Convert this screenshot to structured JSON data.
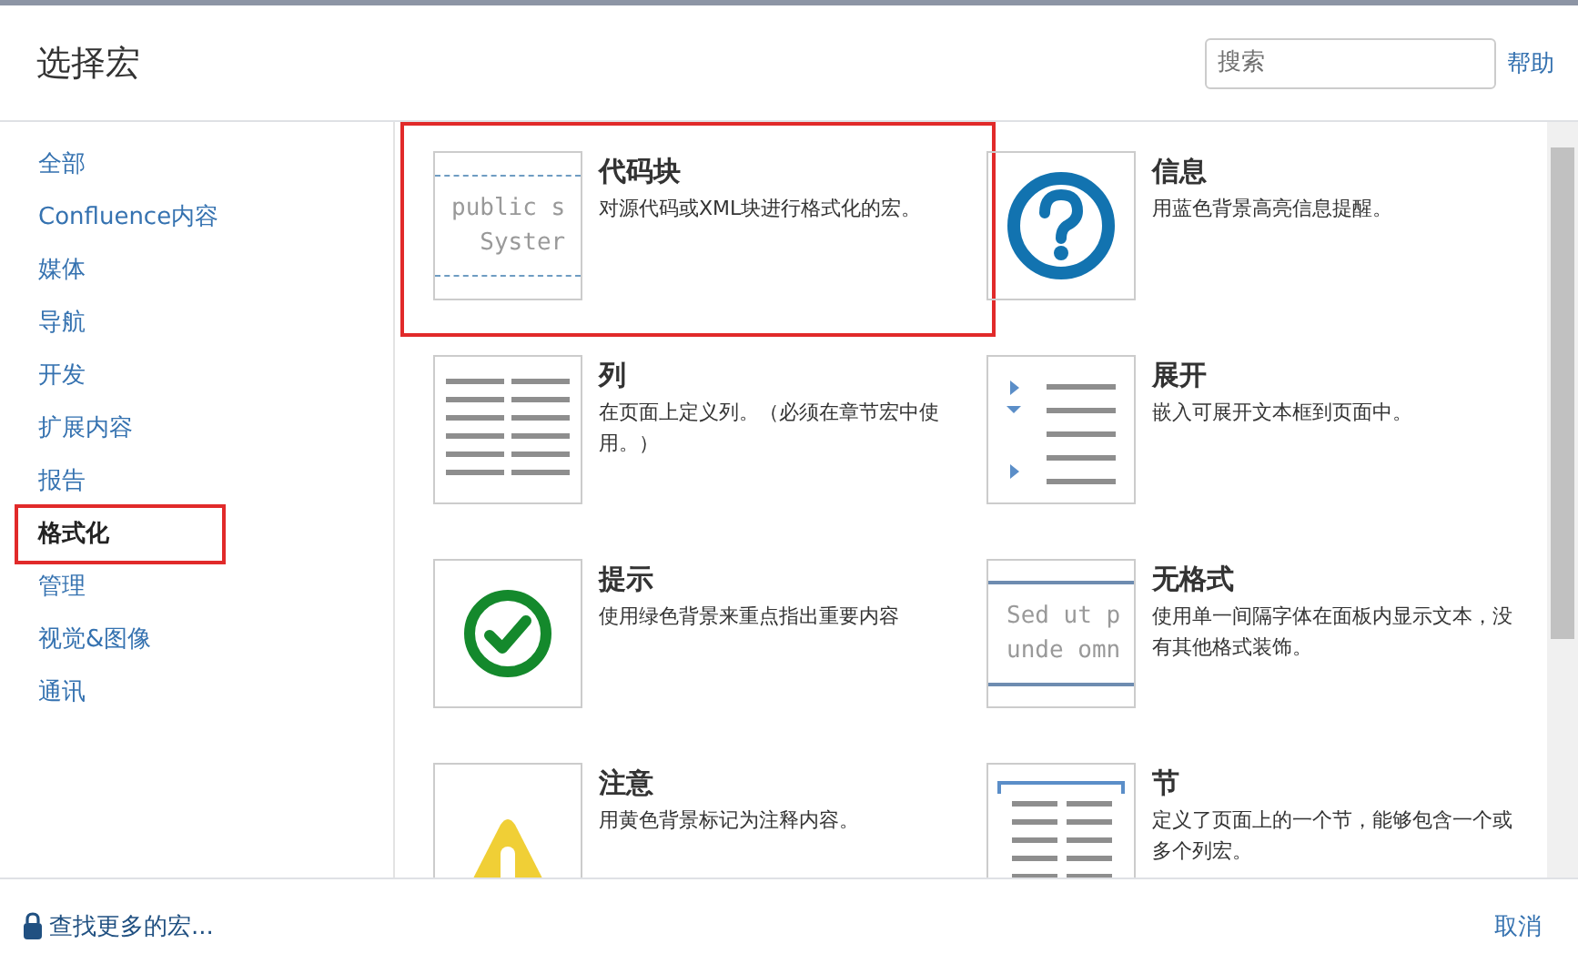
{
  "dialog": {
    "title": "选择宏",
    "search": {
      "placeholder": "搜索"
    },
    "help_link": "帮助"
  },
  "sidebar": {
    "items": [
      {
        "label": "全部",
        "selected": false,
        "annotated": false
      },
      {
        "label": "Confluence内容",
        "selected": false,
        "annotated": false
      },
      {
        "label": "媒体",
        "selected": false,
        "annotated": false
      },
      {
        "label": "导航",
        "selected": false,
        "annotated": false
      },
      {
        "label": "开发",
        "selected": false,
        "annotated": false
      },
      {
        "label": "扩展内容",
        "selected": false,
        "annotated": false
      },
      {
        "label": "报告",
        "selected": false,
        "annotated": false
      },
      {
        "label": "格式化",
        "selected": true,
        "annotated": true
      },
      {
        "label": "管理",
        "selected": false,
        "annotated": false
      },
      {
        "label": "视觉&图像",
        "selected": false,
        "annotated": false
      },
      {
        "label": "通讯",
        "selected": false,
        "annotated": false
      }
    ]
  },
  "macros": [
    {
      "kind": "code",
      "title": "代码块",
      "description": "对源代码或XML块进行格式化的宏。",
      "preview_lines": [
        "public s",
        "  Syster"
      ],
      "annotated": true
    },
    {
      "kind": "info",
      "title": "信息",
      "description": "用蓝色背景高亮信息提醒。",
      "annotated": false
    },
    {
      "kind": "columns",
      "title": "列",
      "description": "在页面上定义列。（必须在章节宏中使用。）",
      "annotated": false
    },
    {
      "kind": "expand",
      "title": "展开",
      "description": "嵌入可展开文本框到页面中。",
      "annotated": false
    },
    {
      "kind": "tip",
      "title": "提示",
      "description": "使用绿色背景来重点指出重要内容",
      "annotated": false
    },
    {
      "kind": "noformat",
      "title": "无格式",
      "description": "使用单一间隔字体在面板内显示文本，没有其他格式装饰。",
      "preview_lines": [
        "Sed ut p",
        "unde omn"
      ],
      "annotated": false
    },
    {
      "kind": "warning",
      "title": "注意",
      "description": "用黄色背景标记为注释内容。",
      "annotated": false
    },
    {
      "kind": "section",
      "title": "节",
      "description": "定义了页面上的一个节，能够包含一个或多个列宏。",
      "annotated": false
    }
  ],
  "footer": {
    "more_link": "查找更多的宏...",
    "cancel_link": "取消"
  }
}
